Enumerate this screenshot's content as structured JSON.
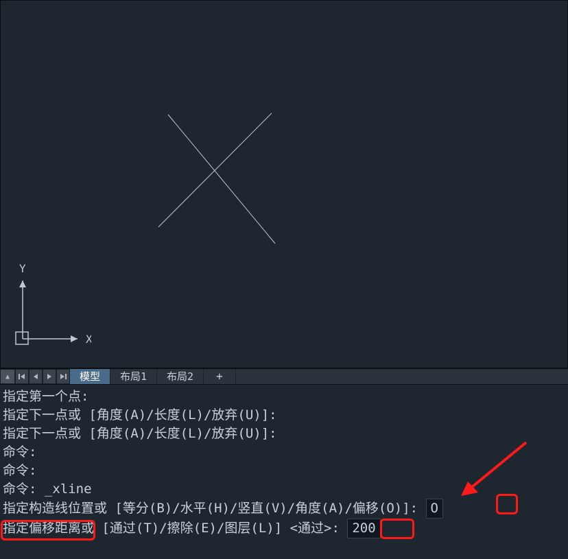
{
  "ucs": {
    "x_label": "X",
    "y_label": "Y"
  },
  "tabs": {
    "model": "模型",
    "layout1": "布局1",
    "layout2": "布局2",
    "add": "+"
  },
  "history": {
    "line1": "指定第一个点:",
    "line2": "指定下一点或 [角度(A)/长度(L)/放弃(U)]:",
    "line3": "指定下一点或 [角度(A)/长度(L)/放弃(U)]:",
    "line4": "命令:",
    "line5": "命令:",
    "line6_prefix": "命令: ",
    "line6_cmd": "_xline",
    "line7_text": "指定构造线位置或  [等分(B)/水平(H)/竖直(V)/角度(A)/偏移(O)]: ",
    "line7_value": "O",
    "line8_part1": "指定偏移距离",
    "line8_part2": "或 [通过(T)/擦除(E)/图层(L)] <通过>: ",
    "line8_value": "200"
  }
}
